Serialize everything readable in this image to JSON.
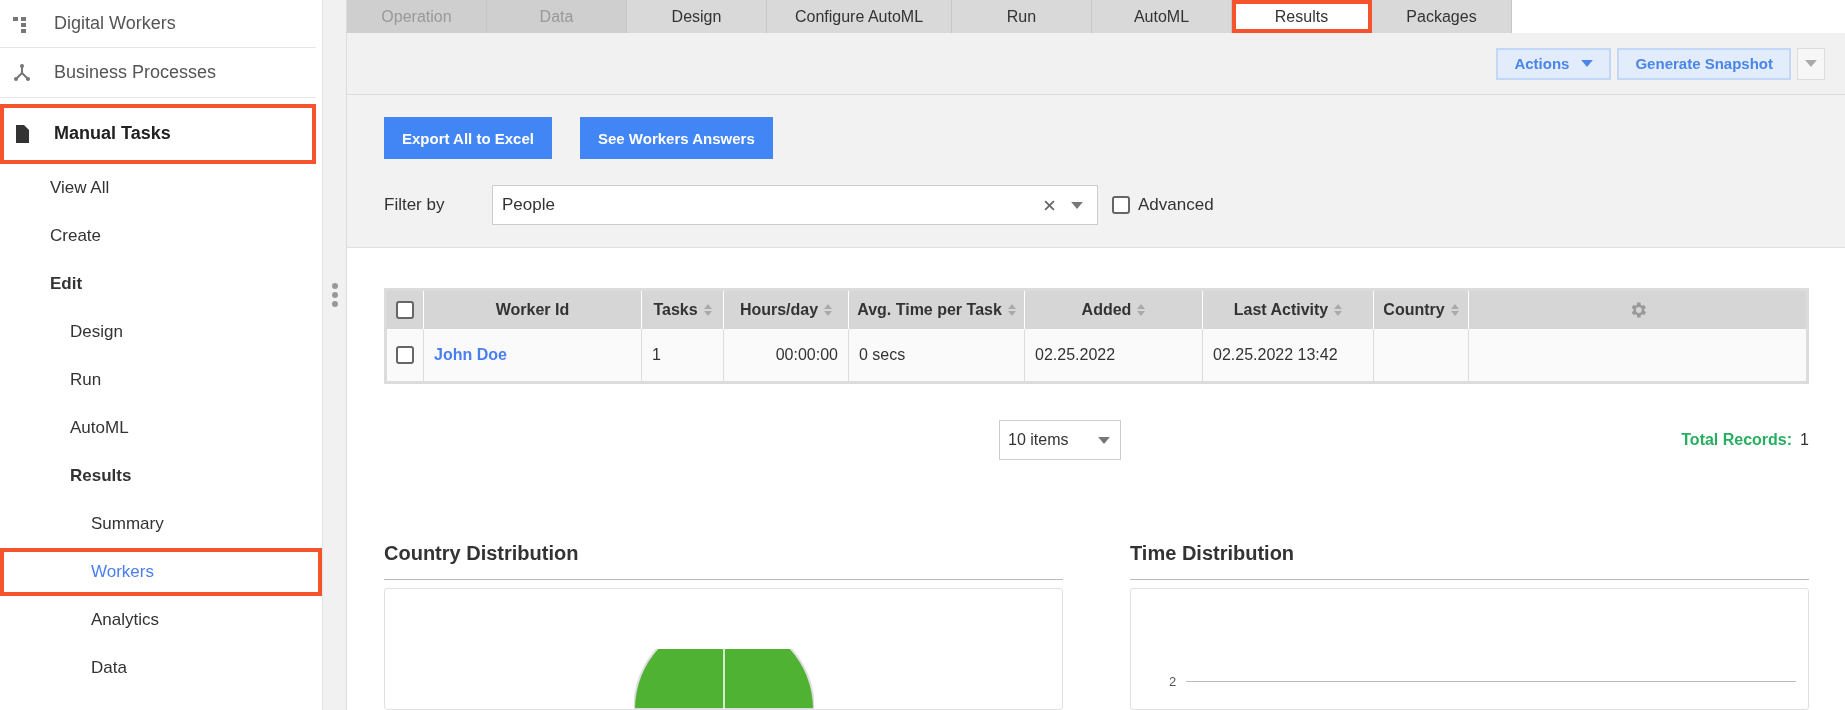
{
  "sidebar": {
    "items": [
      {
        "label": "Digital Workers",
        "kind": "flow",
        "highlighted": false,
        "bold": false
      },
      {
        "label": "Business Processes",
        "kind": "branch",
        "highlighted": false,
        "bold": false
      },
      {
        "label": "Manual Tasks",
        "kind": "document",
        "highlighted": true,
        "bold": true
      }
    ],
    "subitems": [
      {
        "label": "View All",
        "selected": false,
        "expanded": false,
        "highlighted": false
      },
      {
        "label": "Create",
        "selected": false,
        "expanded": false,
        "highlighted": false
      },
      {
        "label": "Edit",
        "selected": false,
        "expanded": true,
        "highlighted": false,
        "children": [
          {
            "label": "Design",
            "selected": false,
            "expanded": false,
            "highlighted": false
          },
          {
            "label": "Run",
            "selected": false,
            "expanded": false,
            "highlighted": false
          },
          {
            "label": "AutoML",
            "selected": false,
            "expanded": false,
            "highlighted": false
          },
          {
            "label": "Results",
            "selected": false,
            "expanded": true,
            "highlighted": false,
            "children": [
              {
                "label": "Summary",
                "selected": false,
                "expanded": false,
                "highlighted": false
              },
              {
                "label": "Workers",
                "selected": true,
                "expanded": false,
                "highlighted": true
              },
              {
                "label": "Analytics",
                "selected": false,
                "expanded": false,
                "highlighted": false
              },
              {
                "label": "Data",
                "selected": false,
                "expanded": false,
                "highlighted": false
              }
            ]
          }
        ]
      }
    ]
  },
  "tabs": [
    {
      "label": "Operation",
      "selected": false,
      "disabled": true,
      "highlighted": false
    },
    {
      "label": "Data",
      "selected": false,
      "disabled": true,
      "highlighted": false
    },
    {
      "label": "Design",
      "selected": false,
      "disabled": false,
      "highlighted": false
    },
    {
      "label": "Configure AutoML",
      "selected": false,
      "disabled": false,
      "highlighted": false
    },
    {
      "label": "Run",
      "selected": false,
      "disabled": false,
      "highlighted": false
    },
    {
      "label": "AutoML",
      "selected": false,
      "disabled": false,
      "highlighted": false
    },
    {
      "label": "Results",
      "selected": true,
      "disabled": false,
      "highlighted": true
    },
    {
      "label": "Packages",
      "selected": false,
      "disabled": false,
      "highlighted": false
    }
  ],
  "toolbar": {
    "actions": "Actions",
    "snapshot": "Generate Snapshot"
  },
  "buttons": [
    "Export All to Excel",
    "See Workers Answers"
  ],
  "filter": {
    "label": "Filter by",
    "value": "People",
    "advanced_label": "Advanced",
    "advanced_checked": false
  },
  "table": {
    "select_all_checked": false,
    "columns": [
      {
        "label": "Worker Id",
        "sortable": false
      },
      {
        "label": "Tasks",
        "sortable": true
      },
      {
        "label": "Hours/day",
        "sortable": true
      },
      {
        "label": "Avg. Time per Task",
        "sortable": true
      },
      {
        "label": "Added",
        "sortable": true
      },
      {
        "label": "Last Activity",
        "sortable": true
      },
      {
        "label": "Country",
        "sortable": true
      }
    ],
    "rows": [
      {
        "checked": false,
        "cells": [
          "John Doe",
          "1",
          "00:00:00",
          "0 secs",
          "02.25.2022",
          "02.25.2022 13:42",
          ""
        ]
      }
    ]
  },
  "pager": {
    "page_size": "10 items",
    "total_label": "Total Records:",
    "total": "1"
  },
  "charts": [
    {
      "title": "Country Distribution",
      "kind": "pie"
    },
    {
      "title": "Time Distribution",
      "kind": "line",
      "y_tick": "2"
    }
  ]
}
